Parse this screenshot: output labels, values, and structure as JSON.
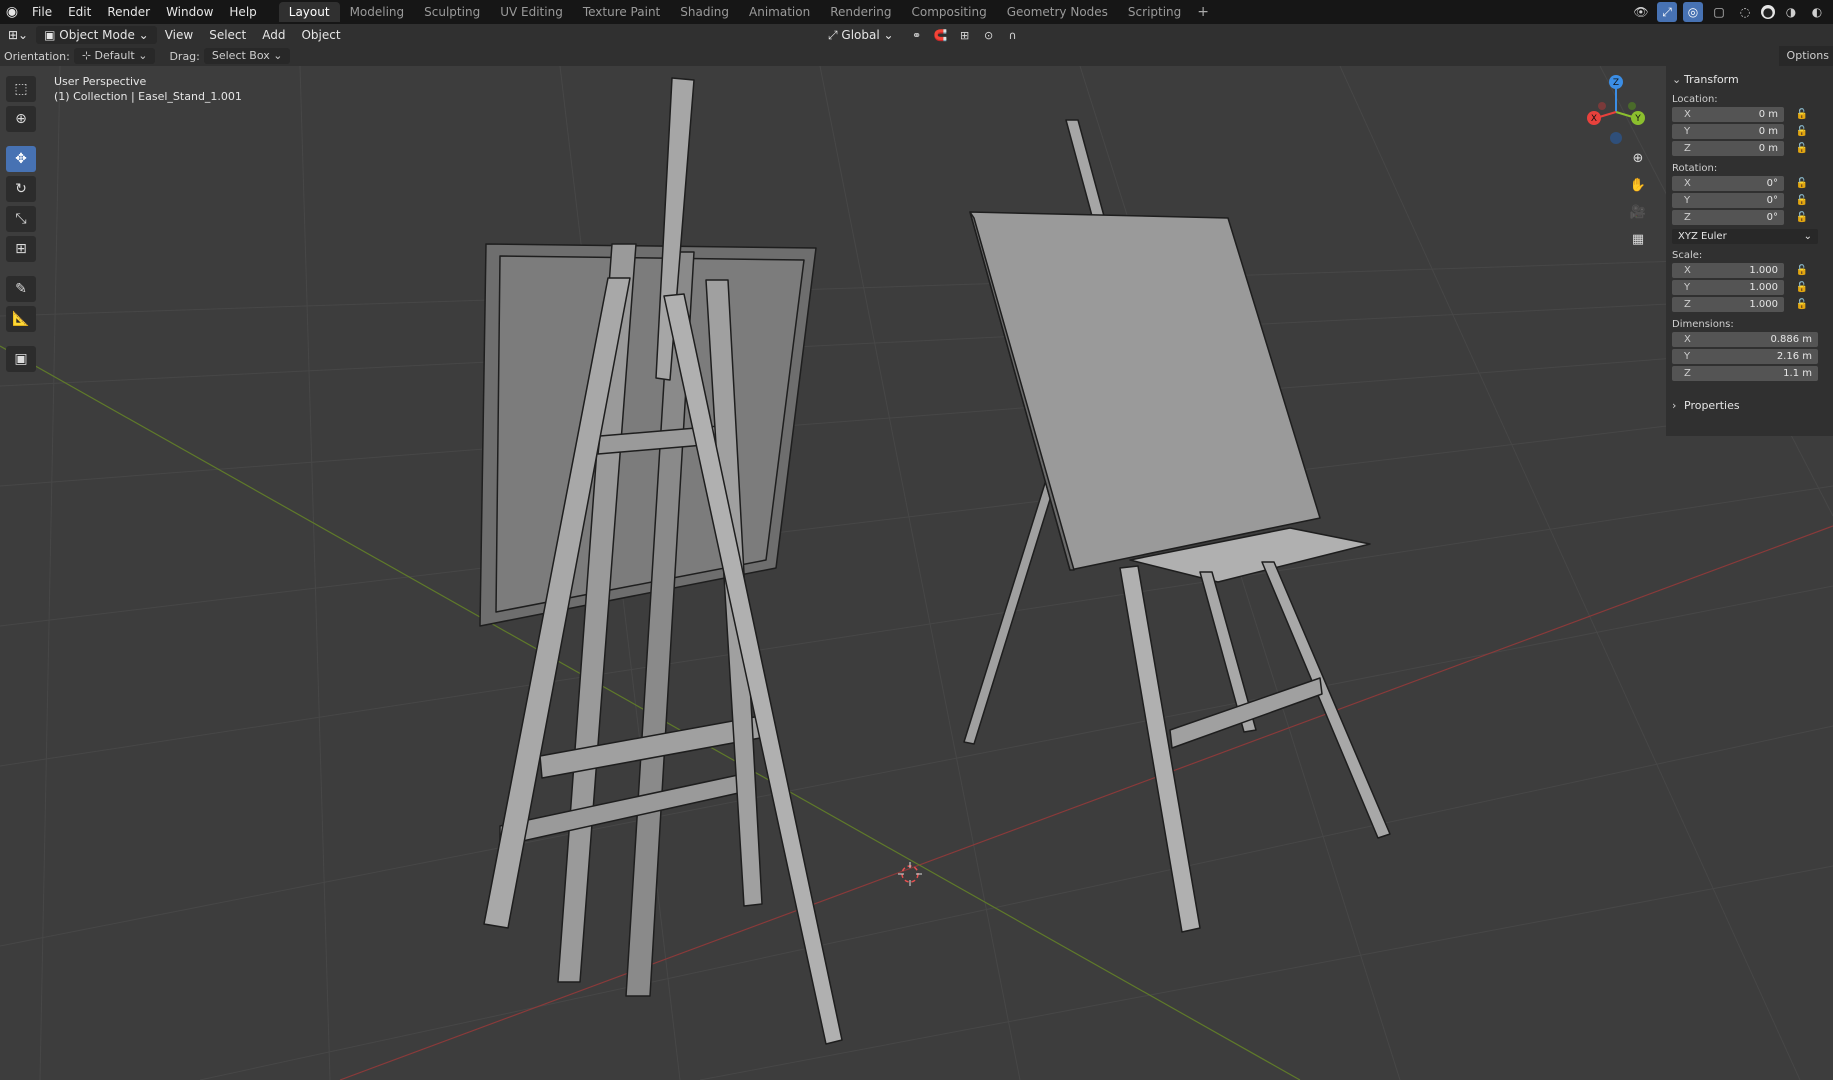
{
  "menu": [
    "File",
    "Edit",
    "Render",
    "Window",
    "Help"
  ],
  "workspaces": [
    {
      "label": "Layout",
      "active": true
    },
    {
      "label": "Modeling"
    },
    {
      "label": "Sculpting"
    },
    {
      "label": "UV Editing"
    },
    {
      "label": "Texture Paint"
    },
    {
      "label": "Shading"
    },
    {
      "label": "Animation"
    },
    {
      "label": "Rendering"
    },
    {
      "label": "Compositing"
    },
    {
      "label": "Geometry Nodes"
    },
    {
      "label": "Scripting"
    }
  ],
  "header": {
    "mode": "Object Mode",
    "view": "View",
    "select": "Select",
    "add": "Add",
    "object": "Object",
    "transform_orientation": "Global"
  },
  "tool_options": {
    "orientation_label": "Orientation:",
    "orientation_value": "Default",
    "drag_label": "Drag:",
    "drag_value": "Select Box",
    "options": "Options"
  },
  "viewport": {
    "perspective": "User Perspective",
    "collection": "(1) Collection | Easel_Stand_1.001"
  },
  "gizmo": {
    "z": "Z",
    "y": "Y",
    "x": "X"
  },
  "npanel": {
    "transform": "Transform",
    "location_label": "Location:",
    "location": [
      {
        "axis": "X",
        "value": "0 m"
      },
      {
        "axis": "Y",
        "value": "0 m"
      },
      {
        "axis": "Z",
        "value": "0 m"
      }
    ],
    "rotation_label": "Rotation:",
    "rotation": [
      {
        "axis": "X",
        "value": "0°"
      },
      {
        "axis": "Y",
        "value": "0°"
      },
      {
        "axis": "Z",
        "value": "0°"
      }
    ],
    "rotation_mode": "XYZ Euler",
    "scale_label": "Scale:",
    "scale": [
      {
        "axis": "X",
        "value": "1.000"
      },
      {
        "axis": "Y",
        "value": "1.000"
      },
      {
        "axis": "Z",
        "value": "1.000"
      }
    ],
    "dimensions_label": "Dimensions:",
    "dimensions": [
      {
        "axis": "X",
        "value": "0.886 m"
      },
      {
        "axis": "Y",
        "value": "2.16 m"
      },
      {
        "axis": "Z",
        "value": "1.1 m"
      }
    ],
    "properties": "Properties"
  },
  "icons": {
    "blender_logo": "◉",
    "add_workspace": "+",
    "select_box": "⬚",
    "cursor": "⊕",
    "move": "✥",
    "rotate": "↻",
    "scale": "⤡",
    "transform": "⊞",
    "annotate": "✎",
    "measure": "📐",
    "add_cube": "▣",
    "zoom": "⊕",
    "pan": "✋",
    "camera": "🎥",
    "grid": "▦",
    "lock": "🔓",
    "dropdown": "⌄",
    "collapse": "⌄",
    "expand": "›"
  },
  "colors": {
    "accent": "#4772b3",
    "x_axis": "#e8413c",
    "y_axis": "#8bbf2e",
    "z_axis": "#3b8ee6"
  }
}
